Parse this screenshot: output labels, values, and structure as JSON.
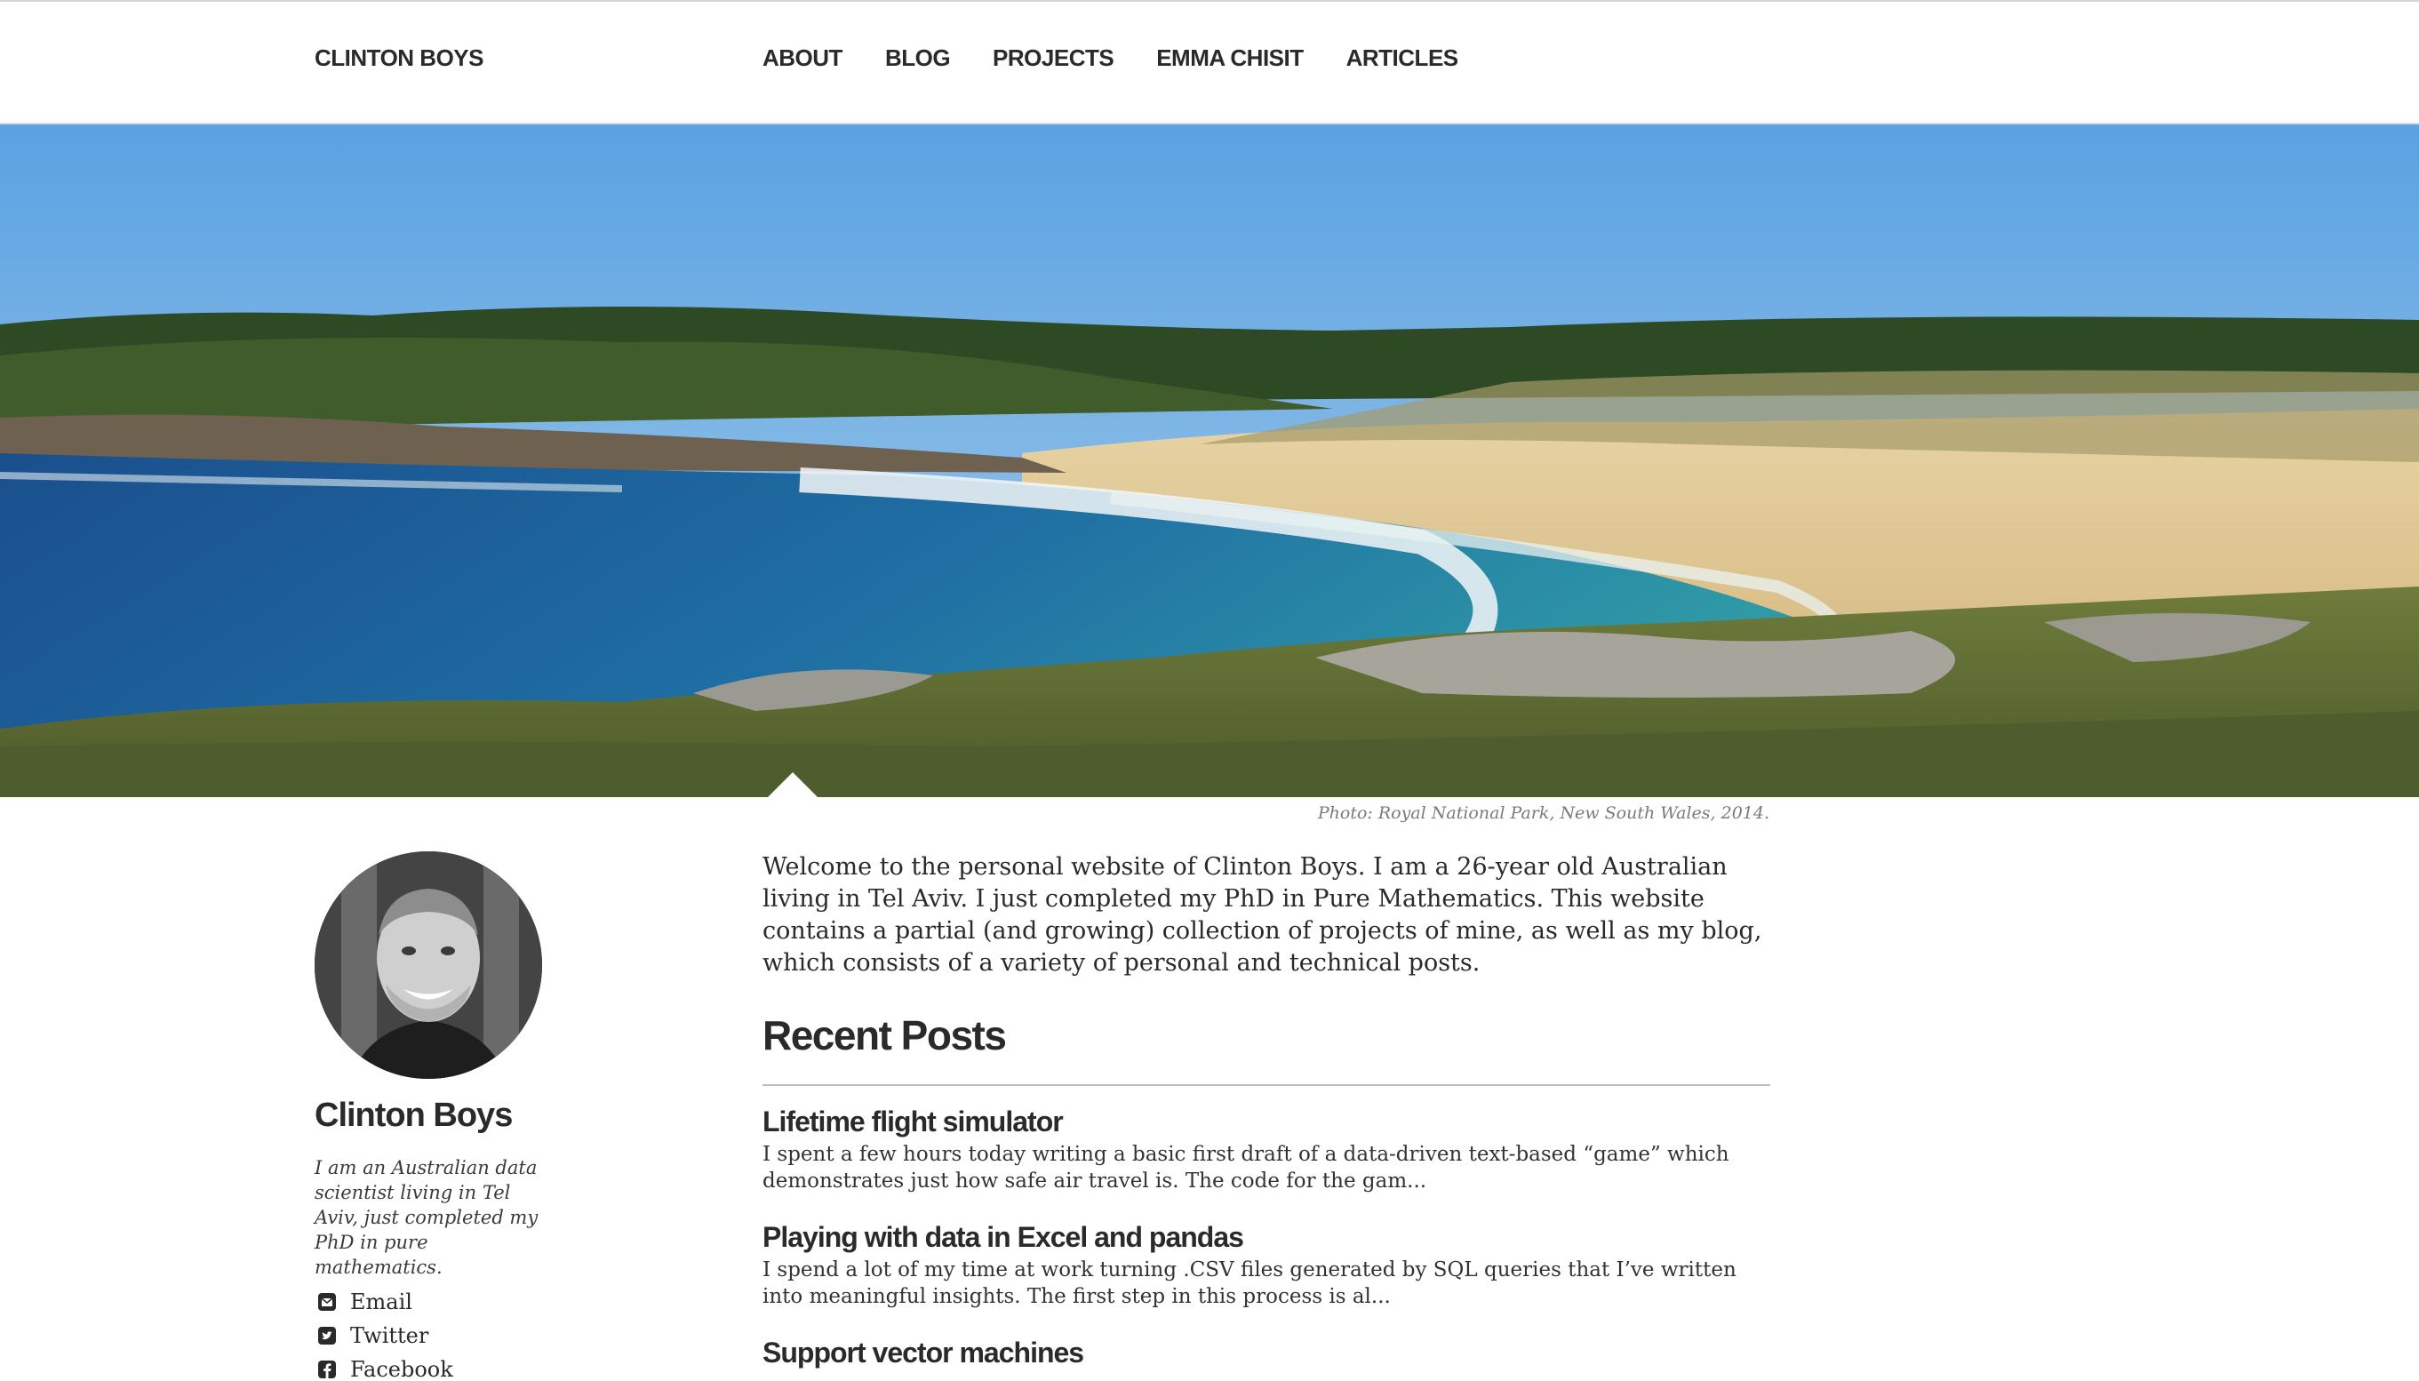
{
  "header": {
    "brand": "CLINTON BOYS",
    "nav": [
      "ABOUT",
      "BLOG",
      "PROJECTS",
      "EMMA CHISIT",
      "ARTICLES"
    ]
  },
  "hero": {
    "caption": "Photo: Royal National Park, New South Wales, 2014."
  },
  "sidebar": {
    "name": "Clinton Boys",
    "bio": "I am an Australian data scientist living in Tel Aviv, just completed my PhD in pure mathematics.",
    "links": [
      {
        "label": "Email",
        "icon": "envelope-icon"
      },
      {
        "label": "Twitter",
        "icon": "twitter-icon"
      },
      {
        "label": "Facebook",
        "icon": "facebook-icon"
      }
    ]
  },
  "main": {
    "intro": "Welcome to the personal website of Clinton Boys. I am a 26-year old Australian living in Tel Aviv. I just completed my PhD in Pure Mathematics. This website contains a partial (and growing) collection of projects of mine, as well as my blog, which consists of a variety of personal and technical posts.",
    "recent_title": "Recent Posts",
    "posts": [
      {
        "title": "Lifetime flight simulator",
        "excerpt": "I spent a few hours today writing a basic first draft of a data-driven text-based “game” which demonstrates just how safe air travel is. The code for the gam..."
      },
      {
        "title": "Playing with data in Excel and pandas",
        "excerpt": "I spend a lot of my time at work turning .CSV files generated by SQL queries that I’ve written into meaningful insights. The first step in this process is al..."
      },
      {
        "title": "Support vector machines",
        "excerpt": ""
      }
    ]
  },
  "colors": {
    "text": "#2a2a2a",
    "rule": "#bdbdbd",
    "caption": "#7a7a7a"
  }
}
